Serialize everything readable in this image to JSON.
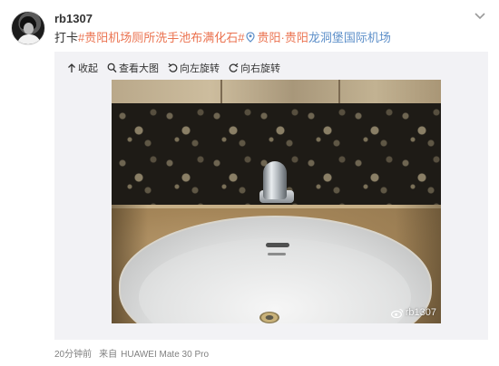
{
  "post": {
    "username": "rb1307",
    "text_prefix": "打卡",
    "hashtag": "#贵阳机场厕所洗手池布满化石#",
    "location_name": "贵阳·贵阳",
    "location_link": "龙洞堡国际机场"
  },
  "toolbar": {
    "collapse_label": "收起",
    "view_large_label": "查看大图",
    "rotate_left_label": "向左旋转",
    "rotate_right_label": "向右旋转"
  },
  "image": {
    "watermark": "rb1307"
  },
  "footer": {
    "time": "20分钟前",
    "source_label": "来自",
    "device": "HUAWEI Mate 30 Pro"
  },
  "colors": {
    "hashtag": "#eb7350",
    "link": "#5d8fc9",
    "panel_bg": "#f2f2f5",
    "meta_text": "#808080"
  },
  "icons": {
    "more": "chevron-down-icon",
    "location": "location-pin-icon",
    "collapse": "arrow-up-icon",
    "view_large": "magnifier-icon",
    "rotate_left": "rotate-left-icon",
    "rotate_right": "rotate-right-icon",
    "watermark": "weibo-logo-icon"
  }
}
